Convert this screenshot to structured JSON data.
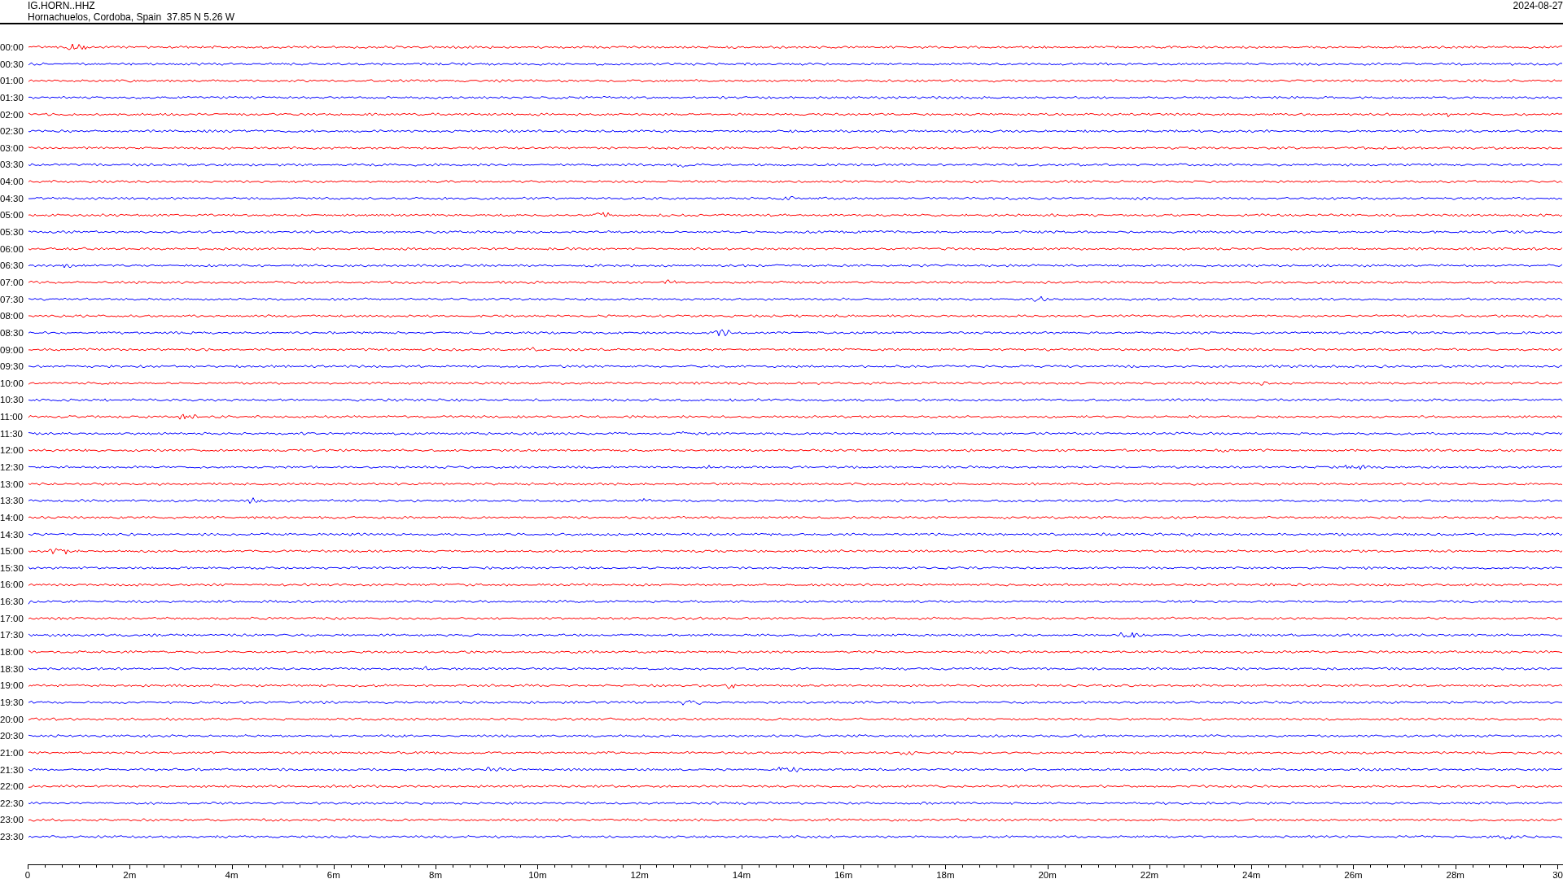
{
  "header": {
    "station": "IG.HORN..HHZ",
    "location": "Hornachuelos, Cordoba, Spain  37.85 N 5.26 W",
    "date": "2024-08-27"
  },
  "rows": [
    {
      "time": "00:00",
      "color": "#ff0000"
    },
    {
      "time": "00:30",
      "color": "#0000ff"
    },
    {
      "time": "01:00",
      "color": "#ff0000"
    },
    {
      "time": "01:30",
      "color": "#0000ff"
    },
    {
      "time": "02:00",
      "color": "#ff0000"
    },
    {
      "time": "02:30",
      "color": "#0000ff"
    },
    {
      "time": "03:00",
      "color": "#ff0000"
    },
    {
      "time": "03:30",
      "color": "#0000ff"
    },
    {
      "time": "04:00",
      "color": "#ff0000"
    },
    {
      "time": "04:30",
      "color": "#0000ff"
    },
    {
      "time": "05:00",
      "color": "#ff0000"
    },
    {
      "time": "05:30",
      "color": "#0000ff"
    },
    {
      "time": "06:00",
      "color": "#ff0000"
    },
    {
      "time": "06:30",
      "color": "#0000ff"
    },
    {
      "time": "07:00",
      "color": "#ff0000"
    },
    {
      "time": "07:30",
      "color": "#0000ff"
    },
    {
      "time": "08:00",
      "color": "#ff0000"
    },
    {
      "time": "08:30",
      "color": "#0000ff"
    },
    {
      "time": "09:00",
      "color": "#ff0000"
    },
    {
      "time": "09:30",
      "color": "#0000ff"
    },
    {
      "time": "10:00",
      "color": "#ff0000"
    },
    {
      "time": "10:30",
      "color": "#0000ff"
    },
    {
      "time": "11:00",
      "color": "#ff0000"
    },
    {
      "time": "11:30",
      "color": "#0000ff"
    },
    {
      "time": "12:00",
      "color": "#ff0000"
    },
    {
      "time": "12:30",
      "color": "#0000ff"
    },
    {
      "time": "13:00",
      "color": "#ff0000"
    },
    {
      "time": "13:30",
      "color": "#0000ff"
    },
    {
      "time": "14:00",
      "color": "#ff0000"
    },
    {
      "time": "14:30",
      "color": "#0000ff"
    },
    {
      "time": "15:00",
      "color": "#ff0000"
    },
    {
      "time": "15:30",
      "color": "#0000ff"
    },
    {
      "time": "16:00",
      "color": "#ff0000"
    },
    {
      "time": "16:30",
      "color": "#0000ff"
    },
    {
      "time": "17:00",
      "color": "#ff0000"
    },
    {
      "time": "17:30",
      "color": "#0000ff"
    },
    {
      "time": "18:00",
      "color": "#ff0000"
    },
    {
      "time": "18:30",
      "color": "#0000ff"
    },
    {
      "time": "19:00",
      "color": "#ff0000"
    },
    {
      "time": "19:30",
      "color": "#0000ff"
    },
    {
      "time": "20:00",
      "color": "#ff0000"
    },
    {
      "time": "20:30",
      "color": "#0000ff"
    },
    {
      "time": "21:00",
      "color": "#ff0000"
    },
    {
      "time": "21:30",
      "color": "#0000ff"
    },
    {
      "time": "22:00",
      "color": "#ff0000"
    },
    {
      "time": "22:30",
      "color": "#0000ff"
    },
    {
      "time": "23:00",
      "color": "#ff0000"
    },
    {
      "time": "23:30",
      "color": "#0000ff"
    }
  ],
  "axis": {
    "labels": [
      "0",
      "2m",
      "4m",
      "6m",
      "8m",
      "10m",
      "12m",
      "14m",
      "16m",
      "18m",
      "20m",
      "22m",
      "24m",
      "26m",
      "28m",
      "30"
    ]
  }
}
